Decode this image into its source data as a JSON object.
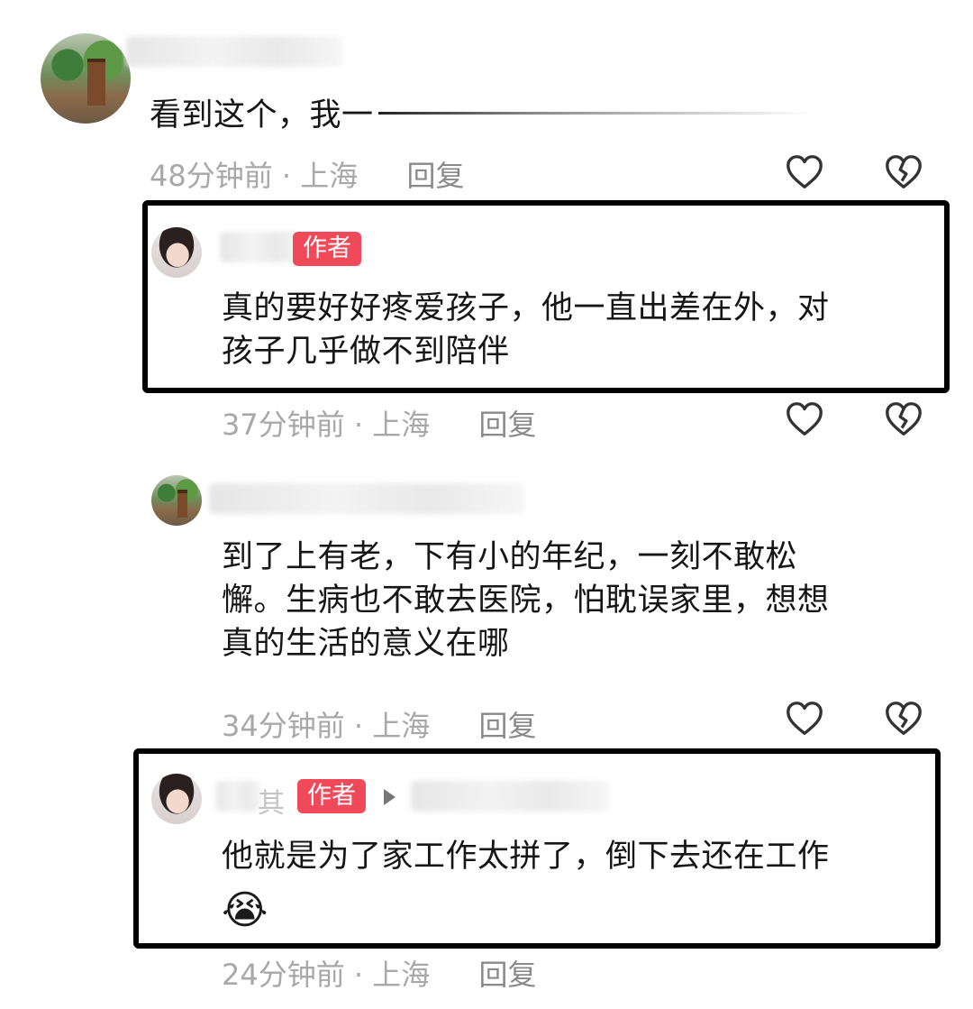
{
  "comments": [
    {
      "text": "看到这个，我一",
      "time": "48分钟前",
      "location": "上海",
      "reply_label": "回复"
    },
    {
      "author_badge": "作者",
      "text_line1": "真的要好好疼爱孩子，他一直出差在外，对",
      "text_line2": "孩子几乎做不到陪伴",
      "time": "37分钟前",
      "location": "上海",
      "reply_label": "回复"
    },
    {
      "text_line1": "到了上有老，下有小的年纪，一刻不敢松",
      "text_line2": "懈。生病也不敢去医院，怕耽误家里，想想",
      "text_line3": "真的生活的意义在哪",
      "time": "34分钟前",
      "location": "上海",
      "reply_label": "回复"
    },
    {
      "name_fragment": "其",
      "author_badge": "作者",
      "text_line1": "他就是为了家工作太拼了，倒下去还在工作",
      "emoji": "😭",
      "time": "24分钟前",
      "location": "上海",
      "reply_label": "回复"
    }
  ],
  "separator": "·",
  "icons": [
    "avatar",
    "heart-icon",
    "broken-heart-icon",
    "play-triangle-icon"
  ]
}
